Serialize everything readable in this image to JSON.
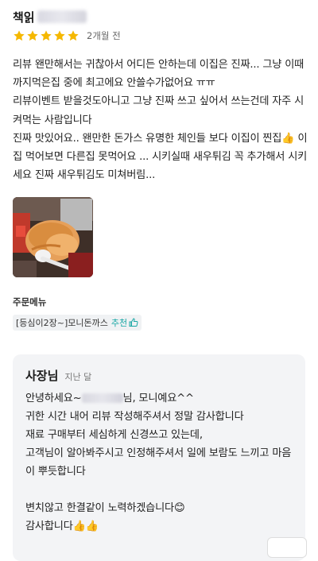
{
  "review": {
    "reviewer_name": "책읽",
    "rating": 5,
    "date": "2개월 전",
    "text": "리뷰 왠만해서는 귀찮아서 어디든 안하는데 이집은 진짜... 그냥 이때까지먹은집 중에 최고에요 안쓸수가없어요 ㅠㅠ\n리뷰이벤트 받을것도아니고 그냥 진짜 쓰고 싶어서 쓰는건데 자주 시켜먹는 사람입니다\n진짜 맛있어요.. 왠만한 돈가스 유명한 체인들 보다 이집이 찐집👍 이집 먹어보면 다른집 못먹어요 ... 시키실때 새우튀김 꼭 추가해서 시키세요 진짜 새우튀김도 미쳐버림...",
    "order_label": "주문메뉴",
    "order_item": "[등심이2장~]모니돈까스",
    "recommend_label": "추천",
    "star_color": "#f5b800",
    "accent_color": "#1aa7a5"
  },
  "reply": {
    "author": "사장님",
    "date": "지난 달",
    "line1_prefix": "안녕하세요~",
    "line1_suffix": "님, 모니예요^^",
    "body": "귀한 시간 내어 리뷰 작성해주셔서 정말 감사합니다\n재료 구매부터 세심하게 신경쓰고 있는데,\n고객님이 알아봐주시고 인정해주셔서 일에 보람도 느끼고 마음이 뿌듯합니다\n\n변치않고 한결같이 노력하겠습니다😊\n감사합니다👍👍"
  }
}
